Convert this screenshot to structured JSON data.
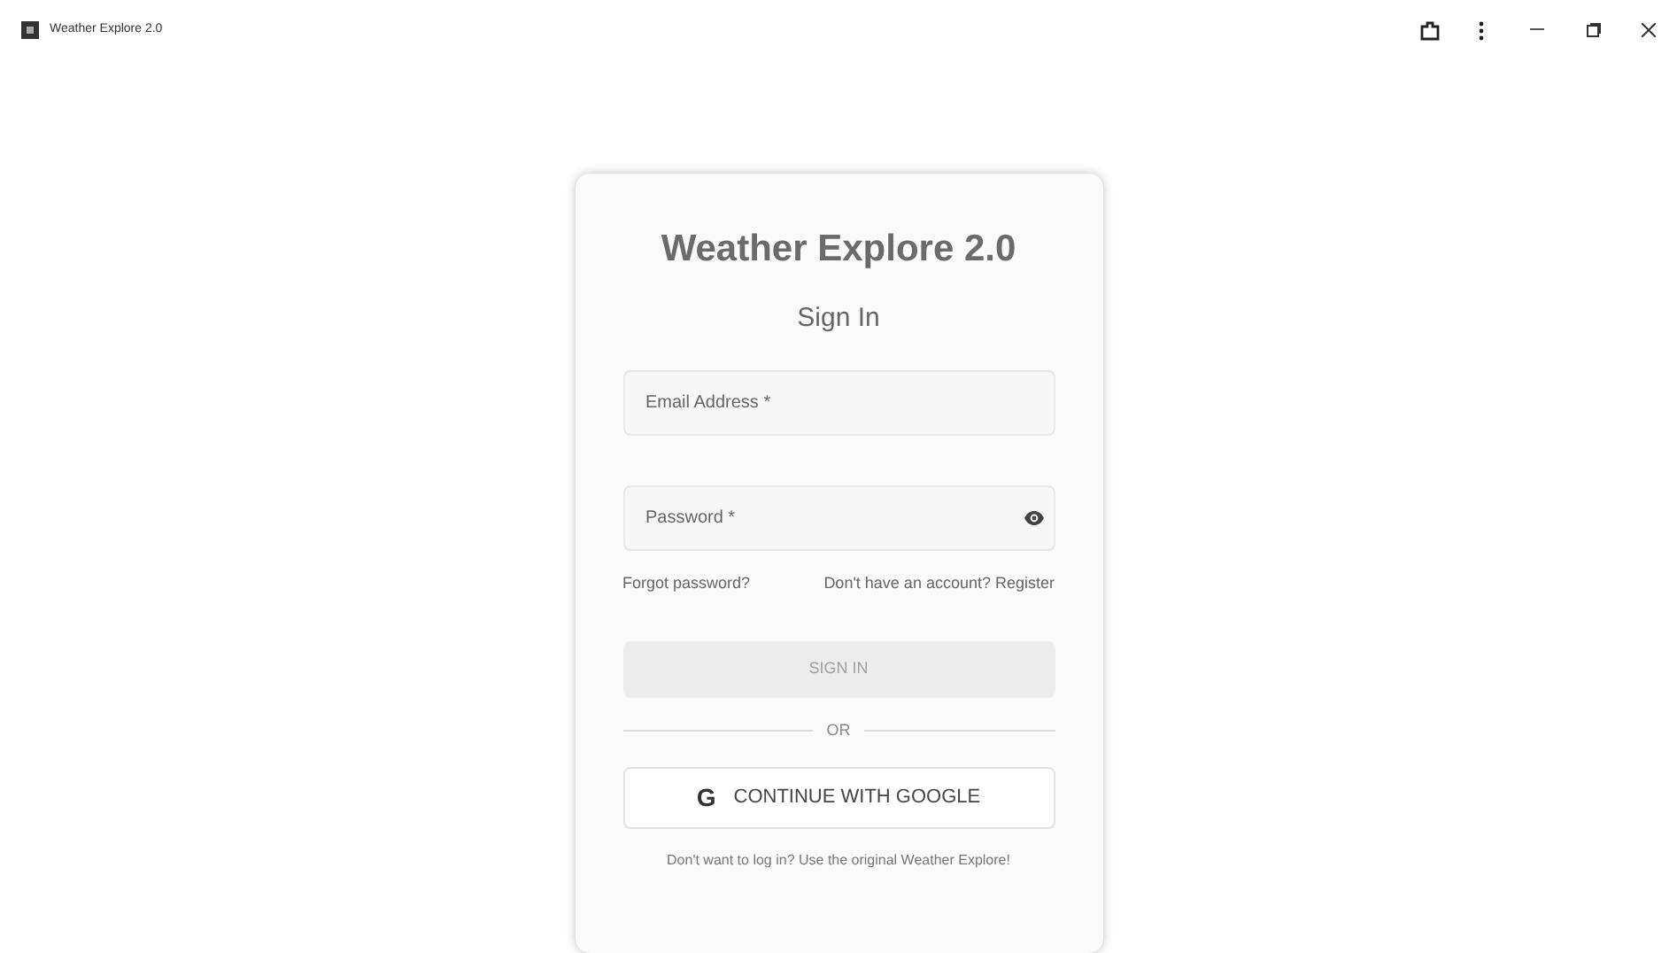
{
  "window": {
    "title": "Weather Explore 2.0"
  },
  "card": {
    "title": "Weather Explore 2.0",
    "subtitle": "Sign In",
    "fields": [
      {
        "kind": "text",
        "placeholder": "Email Address *"
      },
      {
        "kind": "password",
        "placeholder": "Password *"
      }
    ],
    "links": [
      "Forgot password?",
      "Don't have an account? Register"
    ],
    "sign_in_button": {
      "label": "SIGN IN",
      "disabled": true
    },
    "divider": "OR",
    "google_button": {
      "icon": "G",
      "label": "CONTINUE WITH GOOGLE"
    },
    "footer_link": "Don't want to log in? Use the original Weather Explore!"
  }
}
